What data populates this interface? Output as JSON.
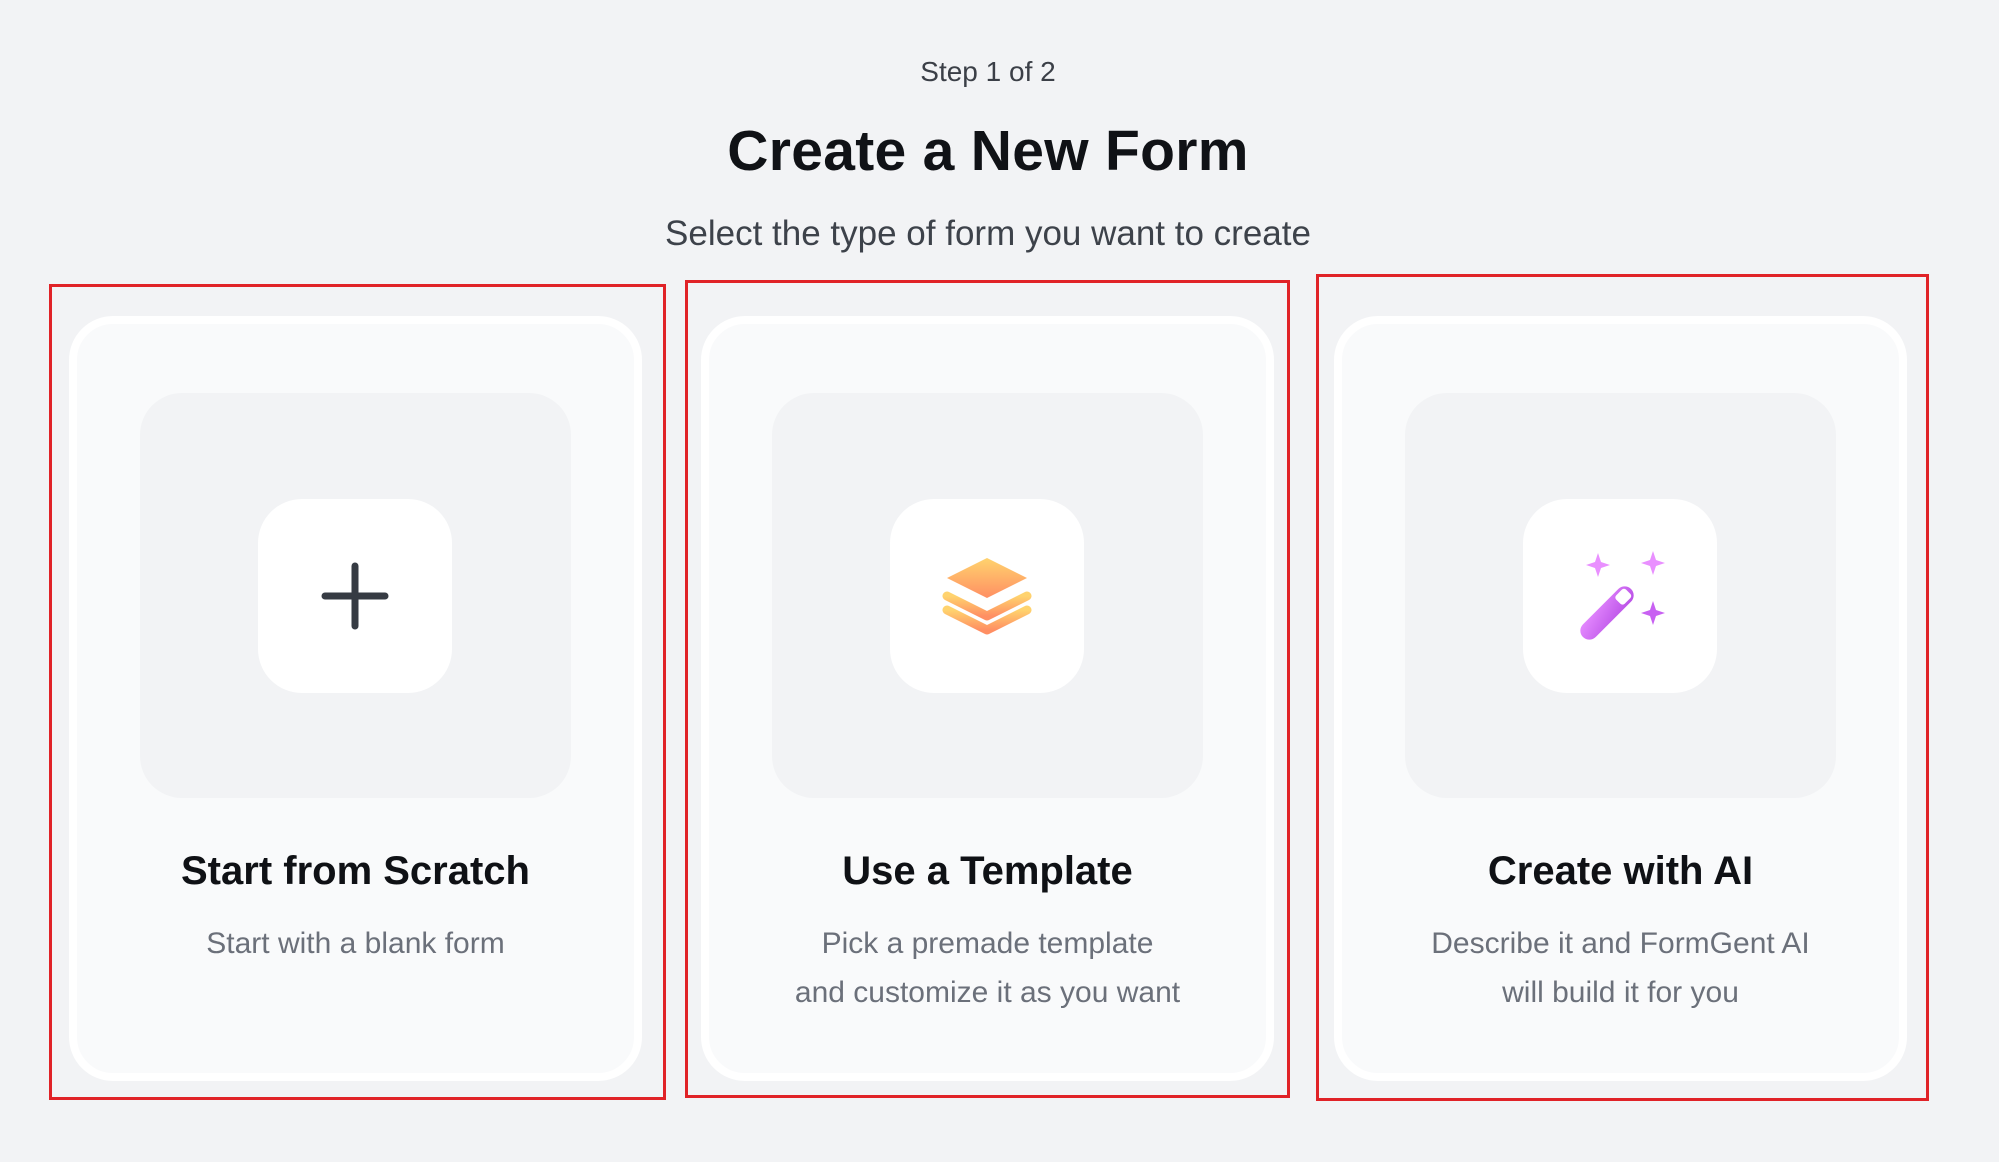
{
  "header": {
    "step": "Step 1 of 2",
    "title": "Create a New Form",
    "subtitle": "Select the type of form you want to create"
  },
  "options": [
    {
      "title": "Start from Scratch",
      "description": [
        "Start with a blank form"
      ],
      "icon": "plus-icon"
    },
    {
      "title": "Use a Template",
      "description": [
        "Pick a premade template",
        "and customize it as you want"
      ],
      "icon": "layers-icon"
    },
    {
      "title": "Create with AI",
      "description": [
        "Describe it and FormGent AI",
        "will build it for you"
      ],
      "icon": "magic-wand-icon"
    }
  ],
  "colors": {
    "background": "#f2f3f5",
    "card": "#f9fafb",
    "highlight_border": "#e02227",
    "template_gradient_top": "#ffd36e",
    "template_gradient_bottom": "#ff8f63",
    "ai_gradient_top": "#e58bff",
    "ai_gradient_bottom": "#b94fe6"
  }
}
